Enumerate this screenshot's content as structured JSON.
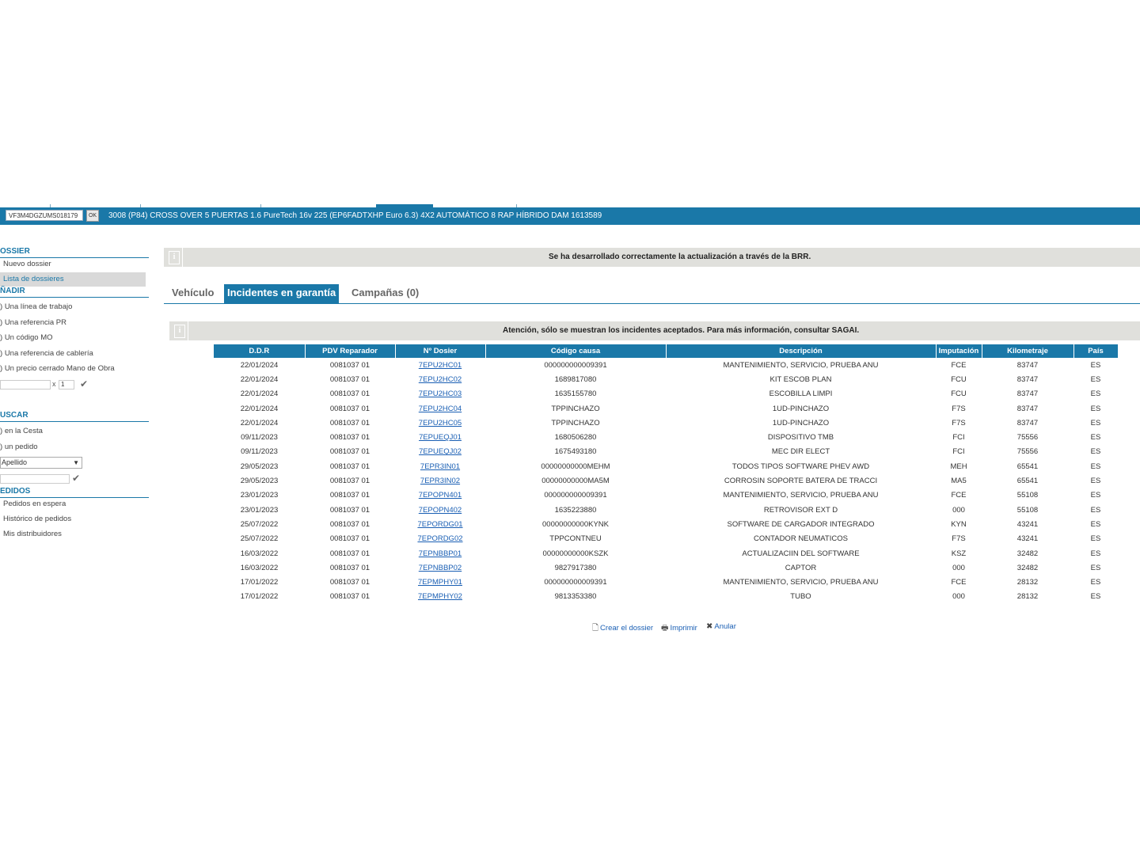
{
  "header": {
    "vin_value": "VF3M4DGZUMS018179",
    "ok_label": "OK",
    "vehicle_description": "3008 (P84) CROSS OVER 5 PUERTAS 1.6 PureTech 16v 225 (EP6FADTXHP Euro 6.3) 4X2 AUTOMÁTICO 8 RAP HÍBRIDO  DAM   1613589"
  },
  "sidebar": {
    "dossier_title": "OSSIER",
    "nuevo_dossier": "Nuevo dossier",
    "lista_dossieres": "Lista de dossieres",
    "anadir_title": "ÑADIR",
    "anadir_items": [
      "Una línea de trabajo",
      "Una referencia PR",
      "Un código MO",
      "Una referencia de cablería",
      "Un precio cerrado Mano de Obra"
    ],
    "qty_x": "x",
    "qty_value": "1",
    "buscar_title": "USCAR",
    "buscar_items": [
      "en la Cesta",
      "un pedido"
    ],
    "select_value": "Apellido",
    "pedidos_title": "EDIDOS",
    "pedidos_items": [
      "Pedidos en espera",
      "Histórico de pedidos",
      "Mis distribuidores"
    ]
  },
  "banner_top": {
    "message": "Se ha desarrollado correctamente la actualización a través de la BRR."
  },
  "tabs": [
    "Vehículo",
    "Incidentes en garantía",
    "Campañas (0)"
  ],
  "banner_table": {
    "message": "Atención, sólo se muestran los incidentes aceptados. Para más información, consultar SAGAI."
  },
  "table": {
    "headers": [
      "D.D.R",
      "PDV Reparador",
      "Nº Dosier",
      "Código causa",
      "Descripción",
      "Imputación",
      "Kilometraje",
      "País"
    ],
    "rows": [
      [
        "22/01/2024",
        "0081037 01",
        "7EPU2HC01",
        "000000000009391",
        "MANTENIMIENTO, SERVICIO, PRUEBA ANU",
        "FCE",
        "83747",
        "ES"
      ],
      [
        "22/01/2024",
        "0081037 01",
        "7EPU2HC02",
        "1689817080",
        "KIT ESCOB PLAN",
        "FCU",
        "83747",
        "ES"
      ],
      [
        "22/01/2024",
        "0081037 01",
        "7EPU2HC03",
        "1635155780",
        "ESCOBILLA LIMPI",
        "FCU",
        "83747",
        "ES"
      ],
      [
        "22/01/2024",
        "0081037 01",
        "7EPU2HC04",
        "TPPINCHAZO",
        "1UD-PINCHAZO",
        "F7S",
        "83747",
        "ES"
      ],
      [
        "22/01/2024",
        "0081037 01",
        "7EPU2HC05",
        "TPPINCHAZO",
        "1UD-PINCHAZO",
        "F7S",
        "83747",
        "ES"
      ],
      [
        "09/11/2023",
        "0081037 01",
        "7EPUEQJ01",
        "1680506280",
        "DISPOSITIVO TMB",
        "FCI",
        "75556",
        "ES"
      ],
      [
        "09/11/2023",
        "0081037 01",
        "7EPUEQJ02",
        "1675493180",
        "MEC DIR ELECT",
        "FCI",
        "75556",
        "ES"
      ],
      [
        "29/05/2023",
        "0081037 01",
        "7EPR3IN01",
        "00000000000MEHM",
        "TODOS TIPOS SOFTWARE PHEV AWD",
        "MEH",
        "65541",
        "ES"
      ],
      [
        "29/05/2023",
        "0081037 01",
        "7EPR3IN02",
        "00000000000MA5M",
        "CORROSIN SOPORTE BATERA DE TRACCI",
        "MA5",
        "65541",
        "ES"
      ],
      [
        "23/01/2023",
        "0081037 01",
        "7EPOPN401",
        "000000000009391",
        "MANTENIMIENTO, SERVICIO, PRUEBA ANU",
        "FCE",
        "55108",
        "ES"
      ],
      [
        "23/01/2023",
        "0081037 01",
        "7EPOPN402",
        "1635223880",
        "RETROVISOR EXT D",
        "000",
        "55108",
        "ES"
      ],
      [
        "25/07/2022",
        "0081037 01",
        "7EPORDG01",
        "00000000000KYNK",
        "SOFTWARE DE CARGADOR INTEGRADO",
        "KYN",
        "43241",
        "ES"
      ],
      [
        "25/07/2022",
        "0081037 01",
        "7EPORDG02",
        "TPPCONTNEU",
        "CONTADOR NEUMATICOS",
        "F7S",
        "43241",
        "ES"
      ],
      [
        "16/03/2022",
        "0081037 01",
        "7EPNBBP01",
        "00000000000KSZK",
        "ACTUALIZACIIN DEL SOFTWARE",
        "KSZ",
        "32482",
        "ES"
      ],
      [
        "16/03/2022",
        "0081037 01",
        "7EPNBBP02",
        "9827917380",
        "CAPTOR",
        "000",
        "32482",
        "ES"
      ],
      [
        "17/01/2022",
        "0081037 01",
        "7EPMPHY01",
        "000000000009391",
        "MANTENIMIENTO, SERVICIO, PRUEBA ANU",
        "FCE",
        "28132",
        "ES"
      ],
      [
        "17/01/2022",
        "0081037 01",
        "7EPMPHY02",
        "9813353380",
        "TUBO",
        "000",
        "28132",
        "ES"
      ]
    ]
  },
  "actions": {
    "crear": "Crear el dossier",
    "imprimir": "Imprimir",
    "anular": "Anular"
  },
  "colors": {
    "accent": "#1a78a8",
    "banner": "#e0e0dc",
    "link": "#1a5fb4"
  }
}
